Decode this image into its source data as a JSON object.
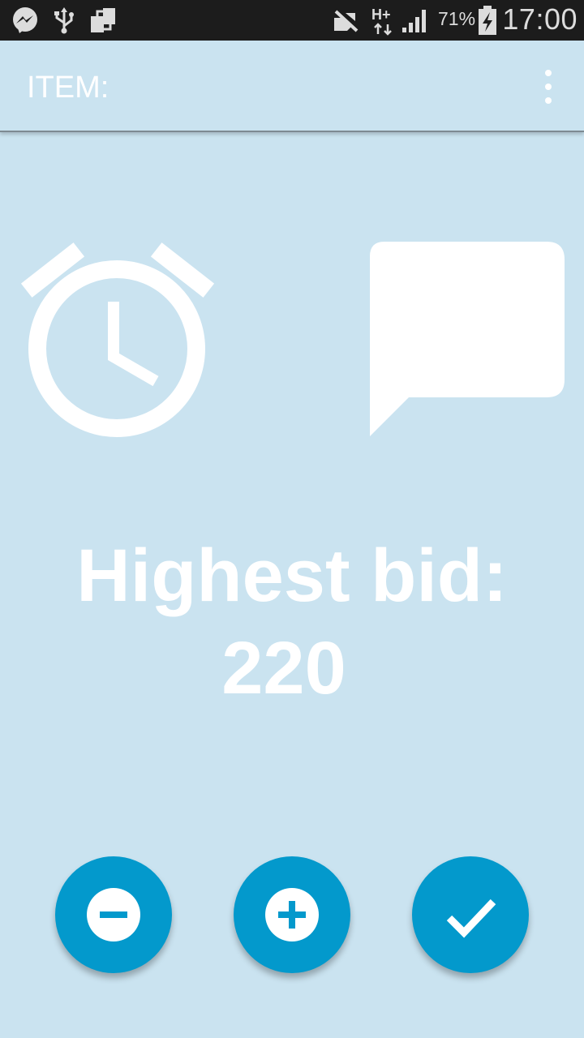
{
  "status_bar": {
    "battery_percent": "71%",
    "time": "17:00",
    "network_type": "H+",
    "icons": [
      "messenger-icon",
      "usb-icon",
      "gallery-icon",
      "mute-icon",
      "network-hplus-icon",
      "signal-icon",
      "battery-charging-icon"
    ]
  },
  "app_bar": {
    "title": "ITEM:",
    "menu_icon": "more-vert-icon"
  },
  "content": {
    "icons": [
      "alarm-clock-icon",
      "chat-bubble-icon"
    ],
    "bid_label": "Highest bid:",
    "bid_value": "220"
  },
  "actions": {
    "decrease_icon": "minus-circle-icon",
    "increase_icon": "plus-circle-icon",
    "confirm_icon": "check-icon"
  },
  "colors": {
    "background": "#cae3f0",
    "accent": "#0399cc",
    "status_bar": "#1c1c1c",
    "text": "#ffffff"
  }
}
